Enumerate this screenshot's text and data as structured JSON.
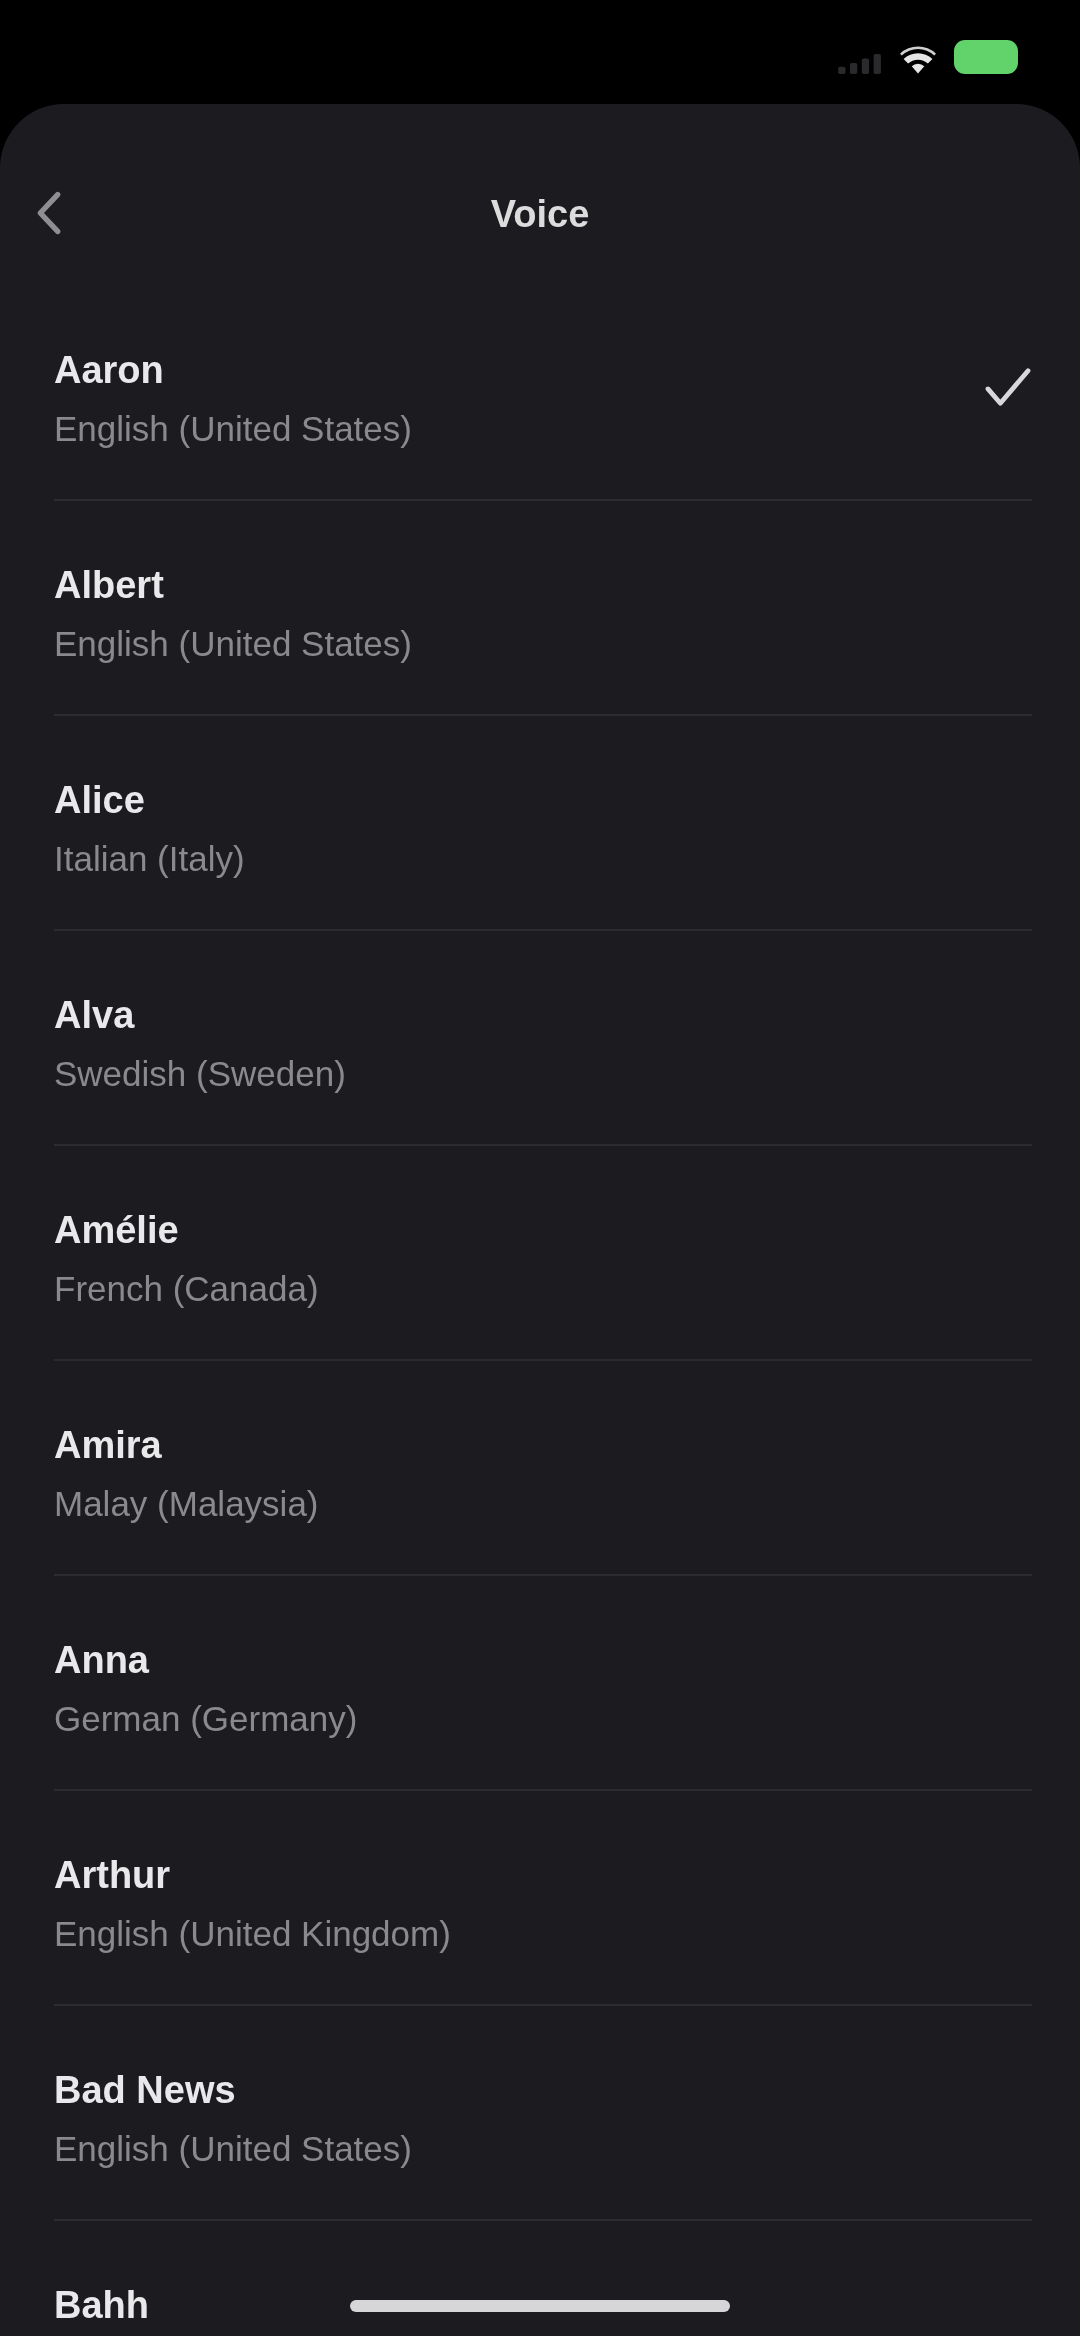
{
  "navigation_bar": {
    "title": "Voice"
  },
  "voices": [
    {
      "name": "Aaron",
      "language": "English (United States)",
      "selected": true
    },
    {
      "name": "Albert",
      "language": "English (United States)",
      "selected": false
    },
    {
      "name": "Alice",
      "language": "Italian (Italy)",
      "selected": false
    },
    {
      "name": "Alva",
      "language": "Swedish (Sweden)",
      "selected": false
    },
    {
      "name": "Amélie",
      "language": "French (Canada)",
      "selected": false
    },
    {
      "name": "Amira",
      "language": "Malay (Malaysia)",
      "selected": false
    },
    {
      "name": "Anna",
      "language": "German (Germany)",
      "selected": false
    },
    {
      "name": "Arthur",
      "language": "English (United Kingdom)",
      "selected": false
    },
    {
      "name": "Bad News",
      "language": "English (United States)",
      "selected": false
    },
    {
      "name": "Bahh",
      "selected": false
    }
  ]
}
